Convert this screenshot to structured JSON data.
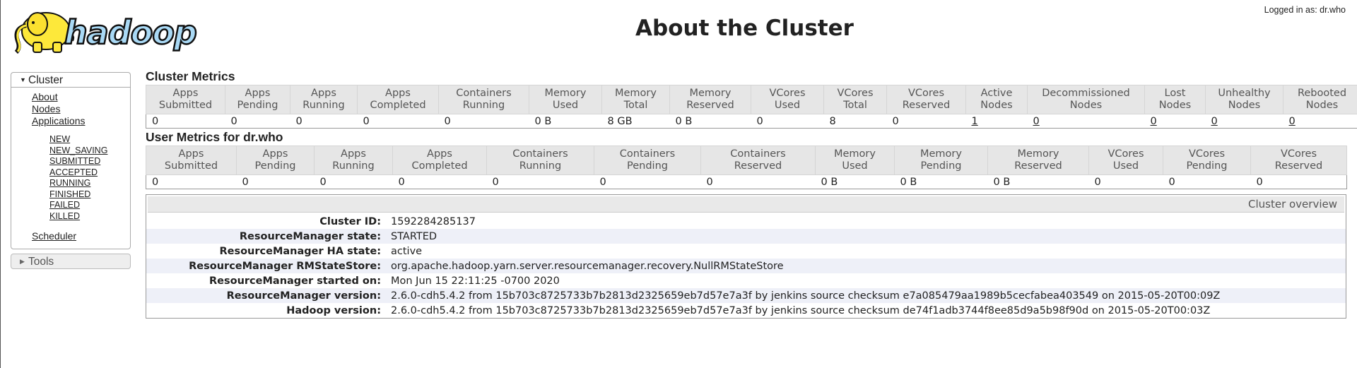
{
  "header": {
    "logo_text": "hadoop",
    "title": "About the Cluster",
    "logged_in": "Logged in as: dr.who"
  },
  "nav": {
    "cluster_label": "Cluster",
    "links": [
      "About",
      "Nodes",
      "Applications"
    ],
    "app_states": [
      "NEW",
      "NEW_SAVING",
      "SUBMITTED",
      "ACCEPTED",
      "RUNNING",
      "FINISHED",
      "FAILED",
      "KILLED"
    ],
    "scheduler": "Scheduler",
    "tools_label": "Tools"
  },
  "cluster_metrics": {
    "title": "Cluster Metrics",
    "headers": [
      [
        "Apps",
        "Submitted"
      ],
      [
        "Apps",
        "Pending"
      ],
      [
        "Apps",
        "Running"
      ],
      [
        "Apps",
        "Completed"
      ],
      [
        "Containers",
        "Running"
      ],
      [
        "Memory",
        "Used"
      ],
      [
        "Memory",
        "Total"
      ],
      [
        "Memory",
        "Reserved"
      ],
      [
        "VCores",
        "Used"
      ],
      [
        "VCores",
        "Total"
      ],
      [
        "VCores",
        "Reserved"
      ],
      [
        "Active",
        "Nodes"
      ],
      [
        "Decommissioned",
        "Nodes"
      ],
      [
        "Lost",
        "Nodes"
      ],
      [
        "Unhealthy",
        "Nodes"
      ],
      [
        "Rebooted",
        "Nodes"
      ]
    ],
    "values": [
      "0",
      "0",
      "0",
      "0",
      "0",
      "0 B",
      "8 GB",
      "0 B",
      "0",
      "8",
      "0",
      "1",
      "0",
      "0",
      "0",
      "0"
    ]
  },
  "user_metrics": {
    "title": "User Metrics for dr.who",
    "headers": [
      [
        "Apps",
        "Submitted"
      ],
      [
        "Apps",
        "Pending"
      ],
      [
        "Apps",
        "Running"
      ],
      [
        "Apps",
        "Completed"
      ],
      [
        "Containers",
        "Running"
      ],
      [
        "Containers",
        "Pending"
      ],
      [
        "Containers",
        "Reserved"
      ],
      [
        "Memory",
        "Used"
      ],
      [
        "Memory",
        "Pending"
      ],
      [
        "Memory",
        "Reserved"
      ],
      [
        "VCores",
        "Used"
      ],
      [
        "VCores",
        "Pending"
      ],
      [
        "VCores",
        "Reserved"
      ]
    ],
    "values": [
      "0",
      "0",
      "0",
      "0",
      "0",
      "0",
      "0",
      "0 B",
      "0 B",
      "0 B",
      "0",
      "0",
      "0"
    ]
  },
  "overview": {
    "heading": "Cluster overview",
    "rows": [
      {
        "key": "Cluster ID:",
        "value": "1592284285137"
      },
      {
        "key": "ResourceManager state:",
        "value": "STARTED"
      },
      {
        "key": "ResourceManager HA state:",
        "value": "active"
      },
      {
        "key": "ResourceManager RMStateStore:",
        "value": "org.apache.hadoop.yarn.server.resourcemanager.recovery.NullRMStateStore"
      },
      {
        "key": "ResourceManager started on:",
        "value": "Mon Jun 15 22:11:25 -0700 2020"
      },
      {
        "key": "ResourceManager version:",
        "value": "2.6.0-cdh5.4.2 from 15b703c8725733b7b2813d2325659eb7d57e7a3f by jenkins source checksum e7a085479aa1989b5cecfabea403549 on 2015-05-20T00:09Z"
      },
      {
        "key": "Hadoop version:",
        "value": "2.6.0-cdh5.4.2 from 15b703c8725733b7b2813d2325659eb7d57e7a3f by jenkins source checksum de74f1adb3744f8ee85d9a5b98f90d on 2015-05-20T00:03Z"
      }
    ]
  },
  "colors": {
    "logo_fill": "#fde83a",
    "logo_text_fill": "#a9d9f5",
    "row_stripe": "#eef0f8"
  }
}
